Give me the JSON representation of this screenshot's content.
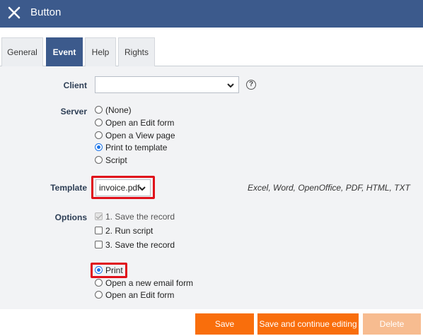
{
  "window": {
    "title": "Button"
  },
  "tabs": [
    {
      "label": "General"
    },
    {
      "label": "Event"
    },
    {
      "label": "Help"
    },
    {
      "label": "Rights"
    }
  ],
  "client": {
    "label": "Client",
    "value": "",
    "help": "?"
  },
  "server": {
    "label": "Server",
    "options": [
      {
        "label": "(None)",
        "checked": false
      },
      {
        "label": "Open an Edit form",
        "checked": false
      },
      {
        "label": "Open a View page",
        "checked": false
      },
      {
        "label": "Print to template",
        "checked": true
      },
      {
        "label": "Script",
        "checked": false
      }
    ]
  },
  "template": {
    "label": "Template",
    "value": "invoice.pdf",
    "hint": "Excel, Word, OpenOffice, PDF, HTML, TXT"
  },
  "options": {
    "label": "Options",
    "checks": [
      {
        "label": "1. Save the record",
        "checked": true,
        "disabled": true
      },
      {
        "label": "2. Run script",
        "checked": false
      },
      {
        "label": "3. Save the record",
        "checked": false
      }
    ],
    "after": [
      {
        "label": "Print",
        "checked": true
      },
      {
        "label": "Open a new email form",
        "checked": false
      },
      {
        "label": "Open an Edit form",
        "checked": false
      }
    ]
  },
  "footer": {
    "save": "Save",
    "save_continue": "Save and continue editing",
    "delete": "Delete"
  },
  "colors": {
    "titlebar": "#3c5a8c",
    "accent": "#f96e0c",
    "highlight": "#e0101a"
  }
}
